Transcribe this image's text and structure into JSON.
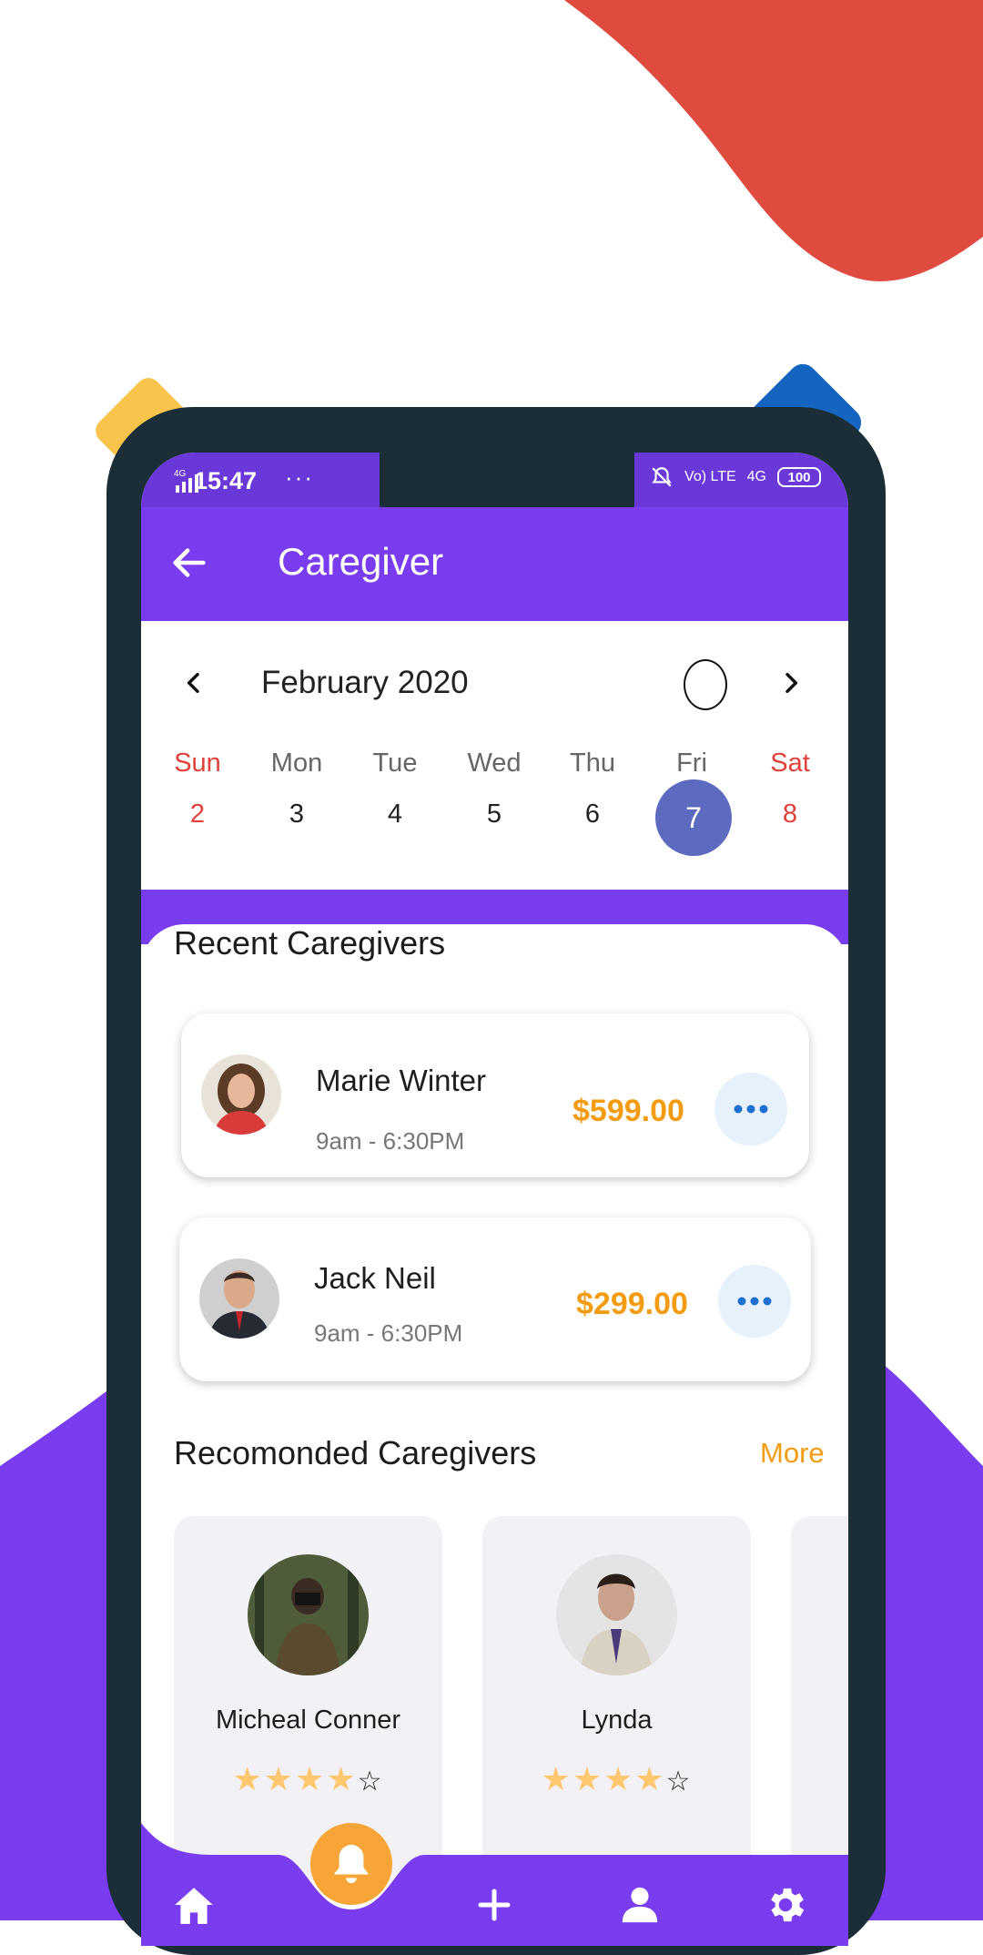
{
  "status_bar": {
    "network": "4G",
    "time": "15:47",
    "more": "···",
    "right_label_1": "Vo) LTE",
    "right_label_2": "4G",
    "battery": "100"
  },
  "app_bar": {
    "title": "Caregiver"
  },
  "calendar": {
    "month": "February 2020",
    "weekdays": [
      "Sun",
      "Mon",
      "Tue",
      "Wed",
      "Thu",
      "Fri",
      "Sat"
    ],
    "dates": [
      "2",
      "3",
      "4",
      "5",
      "6",
      "7",
      "8"
    ],
    "selected": "7"
  },
  "recent": {
    "title": "Recent Caregivers",
    "items": [
      {
        "name": "Marie Winter",
        "hours": "9am - 6:30PM",
        "price": "$599.00"
      },
      {
        "name": "Jack Neil",
        "hours": "9am - 6:30PM",
        "price": "$299.00"
      }
    ]
  },
  "recommended": {
    "title": "Recomonded Caregivers",
    "more": "More",
    "items": [
      {
        "name": "Micheal Conner",
        "rating": 4,
        "max": 5
      },
      {
        "name": "Lynda",
        "rating": 4,
        "max": 5
      }
    ]
  },
  "colors": {
    "primary": "#7a3cef",
    "accent": "#f39c12",
    "weekend": "#e0413b",
    "selected_day": "#5c6bc0",
    "red_blob": "#e04b3f"
  },
  "nav": {
    "items": [
      "home-icon",
      "bell-icon",
      "plus-icon",
      "person-icon",
      "gear-icon"
    ]
  }
}
